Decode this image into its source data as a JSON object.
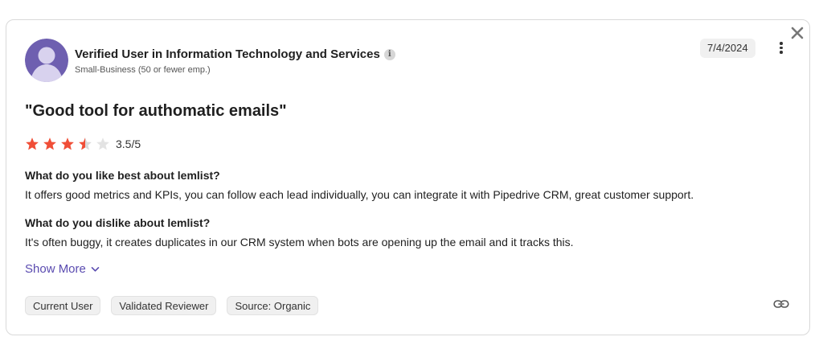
{
  "reviewer": {
    "name": "Verified User in Information Technology and Services",
    "info_glyph": "i",
    "segment": "Small-Business (50 or fewer emp.)"
  },
  "date": "7/4/2024",
  "review": {
    "title": "\"Good tool for authomatic emails\"",
    "rating_value": 3.5,
    "rating_max": 5,
    "rating_text": "3.5/5",
    "questions": [
      {
        "question": "What do you like best about lemlist?",
        "answer": "It offers good metrics and KPIs, you can follow each lead individually, you can integrate it with Pipedrive CRM, great customer support."
      },
      {
        "question": "What do you dislike about lemlist?",
        "answer": "It's often buggy, it creates duplicates in our CRM system when bots are opening up the email and it tracks this."
      }
    ],
    "show_more_label": "Show More"
  },
  "tags": [
    "Current User",
    "Validated Reviewer",
    "Source: Organic"
  ],
  "colors": {
    "star_filled": "#f04e37",
    "star_empty": "#d9d9d9",
    "accent": "#5a4bb0",
    "avatar_bg": "#6e5fb0",
    "avatar_fg": "#d8d2ee"
  },
  "icons": {
    "close": "close-icon",
    "more": "more-vertical-icon",
    "info": "info-icon",
    "chevron": "chevron-down-icon",
    "link": "link-icon",
    "avatar": "user-avatar-icon"
  }
}
